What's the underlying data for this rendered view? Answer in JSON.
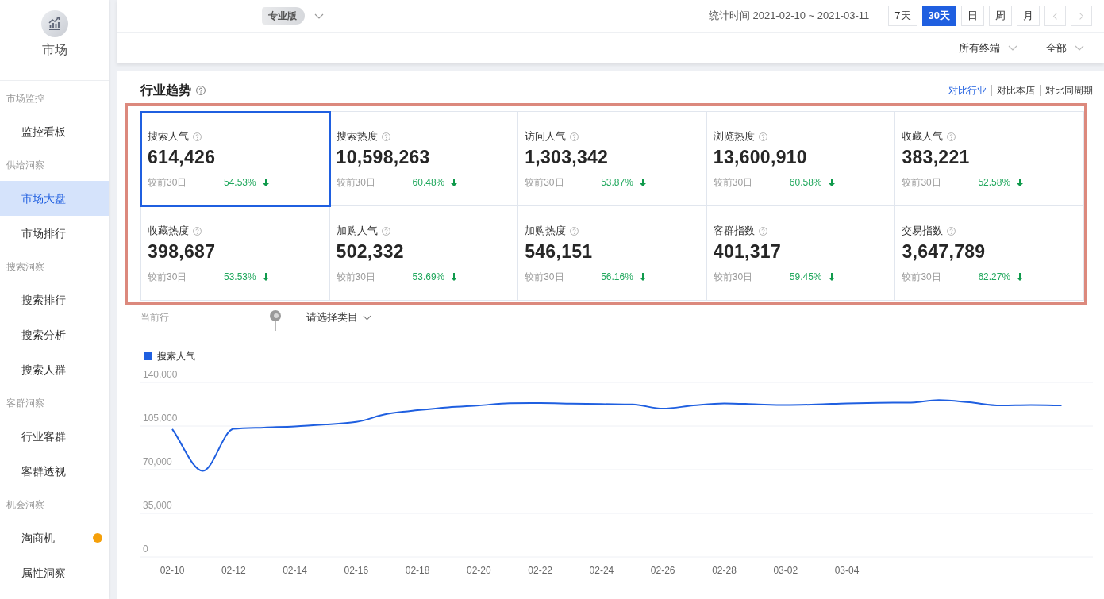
{
  "sidebar": {
    "module": {
      "label": "市场"
    },
    "groups": [
      {
        "title": "市场监控",
        "items": [
          {
            "label": "监控看板",
            "selected": false,
            "notice": false
          }
        ]
      },
      {
        "title": "供给洞察",
        "items": [
          {
            "label": "市场大盘",
            "selected": true,
            "notice": false
          },
          {
            "label": "市场排行",
            "selected": false,
            "notice": false
          }
        ]
      },
      {
        "title": "搜索洞察",
        "items": [
          {
            "label": "搜索排行",
            "selected": false,
            "notice": false
          },
          {
            "label": "搜索分析",
            "selected": false,
            "notice": false
          },
          {
            "label": "搜索人群",
            "selected": false,
            "notice": false
          }
        ]
      },
      {
        "title": "客群洞察",
        "items": [
          {
            "label": "行业客群",
            "selected": false,
            "notice": false
          },
          {
            "label": "客群透视",
            "selected": false,
            "notice": false
          }
        ]
      },
      {
        "title": "机会洞察",
        "items": [
          {
            "label": "淘商机",
            "selected": false,
            "notice": true
          },
          {
            "label": "属性洞察",
            "selected": false,
            "notice": false
          }
        ]
      }
    ]
  },
  "header": {
    "edition_badge": "专业版",
    "date_range": "统计时间 2021-02-10 ~ 2021-03-11",
    "period_buttons": [
      {
        "label": "7天",
        "selected": false
      },
      {
        "label": "30天",
        "selected": true
      },
      {
        "label": "日",
        "selected": false
      },
      {
        "label": "周",
        "selected": false
      },
      {
        "label": "月",
        "selected": false
      }
    ],
    "nav_buttons": [
      {
        "kind": "prev",
        "disabled": true
      },
      {
        "kind": "next",
        "disabled": true
      }
    ],
    "filters": [
      {
        "label": "所有终端"
      },
      {
        "label": "全部"
      }
    ]
  },
  "industry_trend": {
    "title": "行业趋势",
    "compare_links": [
      {
        "label": "对比行业",
        "selected": true
      },
      {
        "label": "对比本店",
        "selected": false
      },
      {
        "label": "对比同周期",
        "selected": false
      }
    ],
    "metrics": [
      {
        "label": "搜索人气",
        "value": "614,426",
        "compare_label": "较前30日",
        "change": "54.53%",
        "decrease": true,
        "selected": true
      },
      {
        "label": "搜索热度",
        "value": "10,598,263",
        "compare_label": "较前30日",
        "change": "60.48%",
        "decrease": true,
        "selected": false
      },
      {
        "label": "访问人气",
        "value": "1,303,342",
        "compare_label": "较前30日",
        "change": "53.87%",
        "decrease": true,
        "selected": false
      },
      {
        "label": "浏览热度",
        "value": "13,600,910",
        "compare_label": "较前30日",
        "change": "60.58%",
        "decrease": true,
        "selected": false
      },
      {
        "label": "收藏人气",
        "value": "383,221",
        "compare_label": "较前30日",
        "change": "52.58%",
        "decrease": true,
        "selected": false
      },
      {
        "label": "收藏热度",
        "value": "398,687",
        "compare_label": "较前30日",
        "change": "53.53%",
        "decrease": true,
        "selected": false
      },
      {
        "label": "加购人气",
        "value": "502,332",
        "compare_label": "较前30日",
        "change": "53.69%",
        "decrease": true,
        "selected": false
      },
      {
        "label": "加购热度",
        "value": "546,151",
        "compare_label": "较前30日",
        "change": "56.16%",
        "decrease": true,
        "selected": false
      },
      {
        "label": "客群指数",
        "value": "401,317",
        "compare_label": "较前30日",
        "change": "59.45%",
        "decrease": true,
        "selected": false
      },
      {
        "label": "交易指数",
        "value": "3,647,789",
        "compare_label": "较前30日",
        "change": "62.27%",
        "decrease": true,
        "selected": false
      }
    ],
    "current_industry": {
      "label": "当前行"
    },
    "category_select": {
      "text": "请选择类目"
    },
    "chart": {
      "chart_data": {
        "type": "line",
        "categories": [
          "02-10",
          null,
          "02-12",
          null,
          "02-14",
          null,
          "02-16",
          null,
          "02-18",
          null,
          "02-20",
          null,
          "02-22",
          null,
          "02-24",
          null,
          "02-26",
          null,
          "02-28",
          null,
          "03-02",
          null,
          "03-04",
          null,
          null,
          null,
          null,
          null,
          null,
          null
        ],
        "series": [
          {
            "name": "搜索人气",
            "color": "#1f5fe0",
            "values": [
              102500,
              69000,
              102700,
              103800,
              104700,
              106200,
              108300,
              114700,
              117700,
              120000,
              121500,
              123300,
              123400,
              123000,
              122600,
              122300,
              119000,
              121500,
              123200,
              122500,
              121800,
              122300,
              123200,
              123600,
              123800,
              125800,
              124000,
              121500,
              121800,
              121500
            ]
          }
        ],
        "ylim": [
          0,
          140000
        ],
        "yticks": [
          {
            "value": 140000,
            "label": "140,000"
          },
          {
            "value": 105000,
            "label": "105,000"
          },
          {
            "value": 70000,
            "label": "70,000"
          },
          {
            "value": 35000,
            "label": "35,000"
          },
          {
            "value": 0,
            "label": "0"
          }
        ],
        "grid": true
      }
    }
  }
}
